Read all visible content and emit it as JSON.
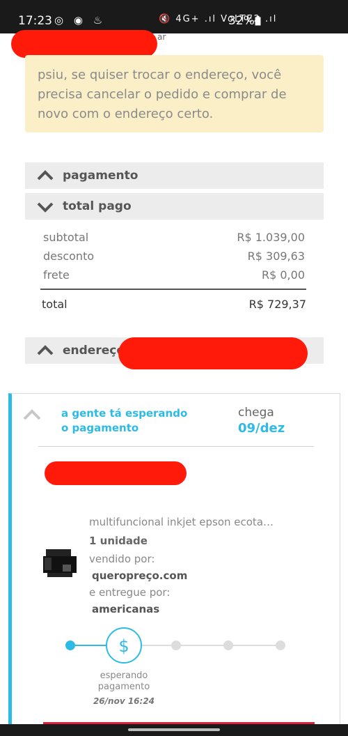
{
  "status_bar": {
    "time": "17:23",
    "left_icons": "◎ ◉ ♨",
    "right_icons": "🔇 4G+ .ıl VoLTE2 .ıl",
    "battery": "32%"
  },
  "top_fragment": "ar",
  "notice": {
    "text": "psiu, se quiser trocar o endereço, você precisa cancelar o pedido e comprar de novo com o endereço certo.",
    "bg_color": "#fbefc8"
  },
  "sections": {
    "payment": "pagamento",
    "total_paid": "total pago",
    "address": "endereço"
  },
  "summary": {
    "subtotal_label": "subtotal",
    "subtotal_value": "R$ 1.039,00",
    "discount_label": "desconto",
    "discount_value": "R$ 309,63",
    "shipping_label": "frete",
    "shipping_value": "R$ 0,00",
    "total_label": "total",
    "total_value": "R$ 729,37"
  },
  "order": {
    "status": "a gente tá esperando o pagamento",
    "arrives_label": "chega",
    "arrives_date": "09/dez",
    "accent_color": "#2dbbe6",
    "product": {
      "name": "multifuncional inkjet epson ecota…",
      "quantity": "1 unidade",
      "sold_by_label": "vendido por:",
      "seller": "queropreço.com",
      "delivered_by_label": "e entregue por:",
      "deliverer": "americanas"
    },
    "tracking": {
      "current_step_label": "esperando pagamento",
      "current_step_time": "26/nov 16:24",
      "steps_total": 5,
      "current_step": 2
    }
  }
}
